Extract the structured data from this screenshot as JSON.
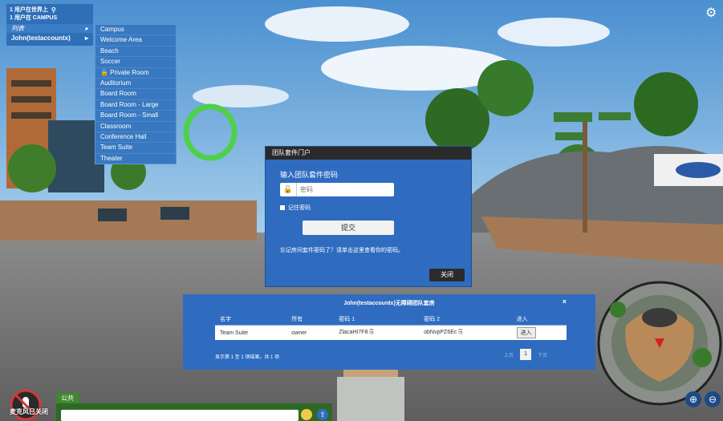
{
  "top_left": {
    "online_count": "1 用户在世界上",
    "campus_count": "1 用户在 CAMPUS",
    "dropdown_label": "列表",
    "user_name": "John(testaccountx)"
  },
  "room_menu": [
    "Campus",
    "Welcome Area",
    "Beach",
    "Soccer",
    "🔒 Private Room",
    "Auditorium",
    "Board Room",
    "Board Room - Large",
    "Board Room - Small",
    "Classroom",
    "Conference Hall",
    "Team Suite",
    "Theater"
  ],
  "password_dialog": {
    "title": "团队套件门户",
    "label": "输入团队套件密码",
    "placeholder": "密码",
    "remember": "记住密码",
    "submit": "提交",
    "help": "忘记房间套件密码了？请单击这里查看你的密码。",
    "close": "关闭"
  },
  "suite_dialog": {
    "title": "John(testaccountx)无障碍团队套房",
    "close_x": "×",
    "headers": [
      "名字",
      "所有",
      "密码 1",
      "密码 2",
      "进入"
    ],
    "row": {
      "name": "Team Suite",
      "owner": "owner",
      "pw1": "ZlacaHI7F8",
      "pw2": "obNvpPZ6Ec",
      "enter": "进入"
    },
    "footer": "显示第 1 至 1 项结果，共 1 项",
    "prev": "上页",
    "page": "1",
    "next": "下页"
  },
  "chat": {
    "tab": "公共",
    "mute_label": "麦克风已关闭"
  },
  "colors": {
    "panel": "#2f6cc0",
    "dark": "#2a2a2a",
    "chat": "#3e8a2f"
  }
}
